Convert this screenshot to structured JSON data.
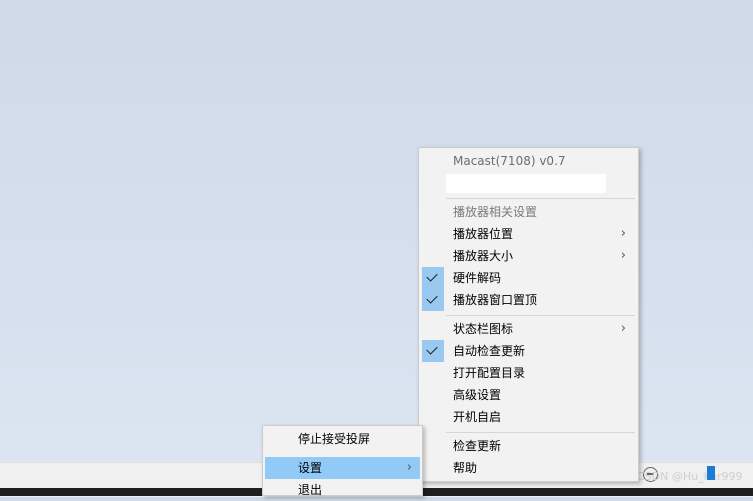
{
  "main_menu": {
    "title": "Macast(7108) v0.7",
    "section_label": "播放器相关设置",
    "items": [
      {
        "label": "播放器位置",
        "submenu": true,
        "checked": false
      },
      {
        "label": "播放器大小",
        "submenu": true,
        "checked": false
      },
      {
        "label": "硬件解码",
        "submenu": false,
        "checked": true
      },
      {
        "label": "播放器窗口置顶",
        "submenu": false,
        "checked": true
      },
      {
        "label": "状态栏图标",
        "submenu": true,
        "checked": false
      },
      {
        "label": "自动检查更新",
        "submenu": false,
        "checked": true
      },
      {
        "label": "打开配置目录",
        "submenu": false,
        "checked": false
      },
      {
        "label": "高级设置",
        "submenu": false,
        "checked": false
      },
      {
        "label": "开机自启",
        "submenu": false,
        "checked": false
      },
      {
        "label": "检查更新",
        "submenu": false,
        "checked": false
      },
      {
        "label": "帮助",
        "submenu": false,
        "checked": false
      }
    ],
    "arrow_glyph": "›"
  },
  "tray_menu": {
    "items": [
      {
        "label": "停止接受投屏"
      },
      {
        "label": "设置",
        "highlighted": true,
        "submenu": true
      },
      {
        "label": "退出"
      }
    ]
  },
  "taskbar": {
    "watermark": "CSDN @Hu_Ker999"
  },
  "colors": {
    "check_bg": "#99c9f0",
    "highlight": "#91c9f7",
    "menu_bg": "#f2f2f2",
    "tray_blue": "#1e7ad8"
  }
}
